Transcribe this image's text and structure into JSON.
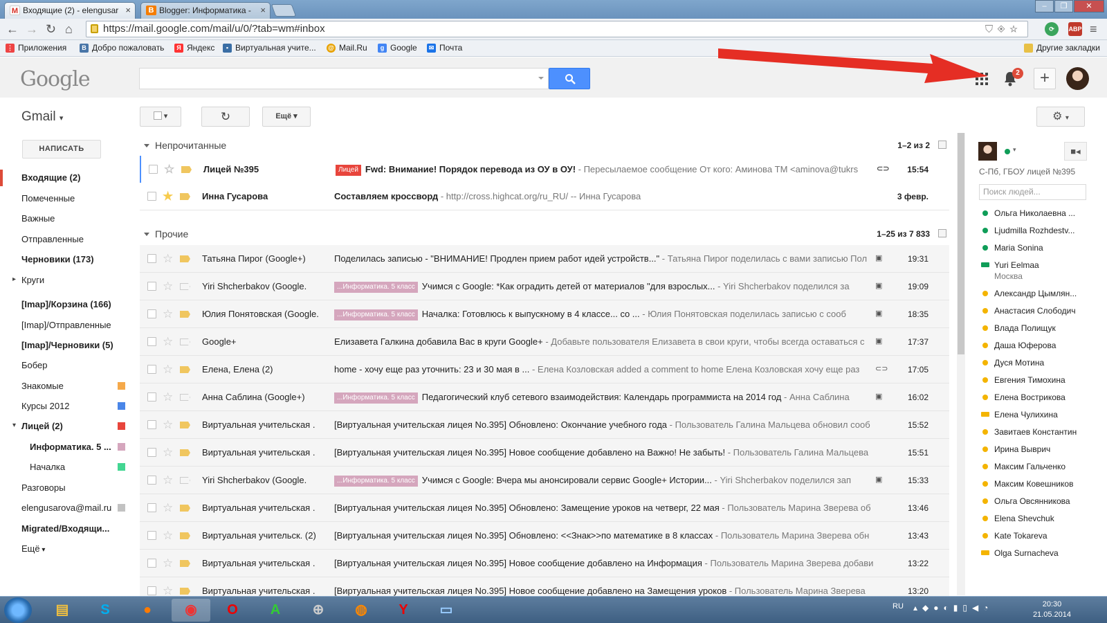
{
  "browser": {
    "tabs": [
      {
        "title": "Входящие (2) - elengusar",
        "icon": "gmail-icon"
      },
      {
        "title": "Blogger: Информатика -",
        "icon": "blogger-icon"
      }
    ],
    "url": "https://mail.google.com/mail/u/0/?tab=wm#inbox",
    "bookmarks": [
      "Приложения",
      "Добро пожаловать",
      "Яндекс",
      "Виртуальная учите...",
      "Mail.Ru",
      "Google",
      "Почта"
    ],
    "other_bookmarks": "Другие закладки",
    "ext_label": "ABP"
  },
  "header": {
    "logo": "Google",
    "notification_count": "2"
  },
  "gmail": {
    "label": "Gmail",
    "compose": "НАПИСАТЬ",
    "more_btn": "Ещё",
    "nav": [
      {
        "label": "Входящие (2)",
        "bold": true,
        "active": true
      },
      {
        "label": "Помеченные"
      },
      {
        "label": "Важные"
      },
      {
        "label": "Отправленные"
      },
      {
        "label": "Черновики (173)",
        "bold": true
      },
      {
        "label": "Круги"
      },
      {
        "label": "[Imap]/Корзина (166)",
        "bold": true
      },
      {
        "label": "[Imap]/Отправленные"
      },
      {
        "label": "[Imap]/Черновики (5)",
        "bold": true
      },
      {
        "label": "Бобер"
      },
      {
        "label": "Знакомые",
        "color": "#f5a94a"
      },
      {
        "label": "Курсы 2012",
        "color": "#4a86e8"
      },
      {
        "label": "Лицей (2)",
        "bold": true,
        "color": "#e8453c"
      },
      {
        "label": "Информатика. 5 ...",
        "bold": true,
        "color": "#d5a6bd"
      },
      {
        "label": "Началка",
        "color": "#43d692"
      },
      {
        "label": "Разговоры"
      },
      {
        "label": "elengusarova@mail.ru",
        "color": "#c2c2c2"
      },
      {
        "label": "Migrated/Входящи...",
        "bold": true
      },
      {
        "label": "Ещё"
      }
    ]
  },
  "sections": {
    "unread": {
      "title": "Непрочитанные",
      "count": "1–2 из 2"
    },
    "other": {
      "title": "Прочие",
      "count": "1–25 из 7 833"
    }
  },
  "unread_rows": [
    {
      "sender": "Лицей №395",
      "label": "Лицей",
      "label_color": "#e8453c",
      "subject": "Fwd: Внимание! Порядок перевода из ОУ в ОУ!",
      "snippet": " - Пересылаемое сообщение От кого: Аминова ТМ <aminova@tukrs",
      "time": "15:54",
      "starred": false,
      "icon": "attach"
    },
    {
      "sender": "Инна Гусарова",
      "label": "",
      "subject": "Составляем кроссворд",
      "snippet": " - http://cross.highcat.org/ru_RU/ -- Инна Гусарова",
      "time": "3 февр.",
      "starred": true,
      "icon": ""
    }
  ],
  "other_rows": [
    {
      "sender": "Татьяна Пирог (Google+)",
      "label": "",
      "subject": "Поделилась записью - \"ВНИМАНИЕ! Продлен прием работ идей устройств...\"",
      "snippet": " - Татьяна Пирог поделилась с вами записью Пол",
      "time": "19:31",
      "imp": true,
      "icon": "gplus"
    },
    {
      "sender": "Yiri Shcherbakov (Google.",
      "label": "...Информатика. 5 класс",
      "label_color": "#d5a6bd",
      "subject": "Учимся с Google: *Как оградить детей от материалов \"для взрослых...",
      "snippet": " - Yiri Shcherbakov поделился за",
      "time": "19:09",
      "imp": false,
      "icon": "gplus"
    },
    {
      "sender": "Юлия Понятовская (Google.",
      "label": "...Информатика. 5 класс",
      "label_color": "#d5a6bd",
      "subject": "Началка: Готовлюсь к выпускному в 4 классе... co ...",
      "snippet": " - Юлия Понятовская поделилась записью с сооб",
      "time": "18:35",
      "imp": true,
      "icon": "gplus"
    },
    {
      "sender": "Google+",
      "label": "",
      "subject": "Елизавета Галкина добавила Вас в круги Google+",
      "snippet": " - Добавьте пользователя Елизавета в свои круги, чтобы всегда оставаться с",
      "time": "17:37",
      "imp": false,
      "icon": "gplus"
    },
    {
      "sender": "Елена, Елена (2)",
      "label": "",
      "subject": "home - хочу еще раз уточнить: 23 и 30 мая в ...",
      "snippet": " - Елена Козловская added a comment to home Елена Козловская хочу еще раз",
      "time": "17:05",
      "imp": true,
      "icon": "attach"
    },
    {
      "sender": "Анна Саблина (Google+)",
      "label": "...Информатика. 5 класс",
      "label_color": "#d5a6bd",
      "subject": "Педагогический клуб сетевого взаимодействия: Календарь программиста на 2014 год",
      "snippet": " - Анна Саблина",
      "time": "16:02",
      "imp": false,
      "icon": "gplus"
    },
    {
      "sender": "Виртуальная учительская .",
      "label": "",
      "subject": "[Виртуальная учительская лицея No.395] Обновлено: Окончание учебного года",
      "snippet": " - Пользователь Галина Мальцева обновил сооб",
      "time": "15:52",
      "imp": true,
      "icon": ""
    },
    {
      "sender": "Виртуальная учительская .",
      "label": "",
      "subject": "[Виртуальная учительская лицея No.395] Новое сообщение добавлено на Важно! Не забыть!",
      "snippet": " - Пользователь Галина Мальцева",
      "time": "15:51",
      "imp": true,
      "icon": ""
    },
    {
      "sender": "Yiri Shcherbakov (Google.",
      "label": "...Информатика. 5 класс",
      "label_color": "#d5a6bd",
      "subject": "Учимся с Google: Вчера мы анонсировали сервис Google+ Истории...",
      "snippet": " - Yiri Shcherbakov поделился зап",
      "time": "15:33",
      "imp": false,
      "icon": "gplus"
    },
    {
      "sender": "Виртуальная учительская .",
      "label": "",
      "subject": "[Виртуальная учительская лицея No.395] Обновлено: Замещение уроков на четверг, 22 мая",
      "snippet": " - Пользователь Марина Зверева об",
      "time": "13:46",
      "imp": true,
      "icon": ""
    },
    {
      "sender": "Виртуальная учительск. (2)",
      "label": "",
      "subject": "[Виртуальная учительская лицея No.395] Обновлено: <<Знак>>по математике в 8 классах",
      "snippet": " - Пользователь Марина Зверева обн",
      "time": "13:43",
      "imp": true,
      "icon": ""
    },
    {
      "sender": "Виртуальная учительская .",
      "label": "",
      "subject": "[Виртуальная учительская лицея No.395] Новое сообщение добавлено на Информация",
      "snippet": " - Пользователь Марина Зверева добави",
      "time": "13:22",
      "imp": true,
      "icon": ""
    },
    {
      "sender": "Виртуальная учительская .",
      "label": "",
      "subject": "[Виртуальная учительская лицея No.395] Новое сообщение добавлено на Замещения уроков",
      "snippet": " - Пользователь Марина Зверева",
      "time": "13:20",
      "imp": true,
      "icon": ""
    }
  ],
  "right_panel": {
    "subtitle": "С-Пб, ГБОУ лицей №395",
    "people_placeholder": "Поиск людей...",
    "contacts": [
      {
        "name": "Ольга Николаевна ...",
        "status": "#0f9d58"
      },
      {
        "name": "Ljudmilla Rozhdestv...",
        "status": "#0f9d58"
      },
      {
        "name": "Maria Sonina",
        "status": "#0f9d58"
      },
      {
        "name": "Yuri Eelmaa",
        "sub": "Москва",
        "status": "#0f9d58",
        "video": true
      },
      {
        "name": "Александр Цымлян...",
        "status": "#f4b400"
      },
      {
        "name": "Анастасия Слободич",
        "status": "#f4b400"
      },
      {
        "name": "Влада Полищук",
        "status": "#f4b400"
      },
      {
        "name": "Даша Юферова",
        "status": "#f4b400"
      },
      {
        "name": "Дуся Мотина",
        "status": "#f4b400"
      },
      {
        "name": "Евгения Тимохина",
        "status": "#f4b400"
      },
      {
        "name": "Елена Вострикова",
        "status": "#f4b400"
      },
      {
        "name": "Елена Чулихина",
        "status": "#f4b400",
        "video": true
      },
      {
        "name": "Завитаев Константин",
        "status": "#f4b400"
      },
      {
        "name": "Ирина Выврич",
        "status": "#f4b400"
      },
      {
        "name": "Максим Гальченко",
        "status": "#f4b400"
      },
      {
        "name": "Максим Ковешников",
        "status": "#f4b400"
      },
      {
        "name": "Ольга Овсянникова",
        "status": "#f4b400"
      },
      {
        "name": "Elena Shevchuk",
        "status": "#f4b400"
      },
      {
        "name": "Kate Tokareva",
        "status": "#f4b400"
      },
      {
        "name": "Olga Surnacheva",
        "status": "#f4b400",
        "video": true
      }
    ]
  },
  "taskbar": {
    "lang": "RU",
    "time": "20:30",
    "date": "21.05.2014"
  }
}
